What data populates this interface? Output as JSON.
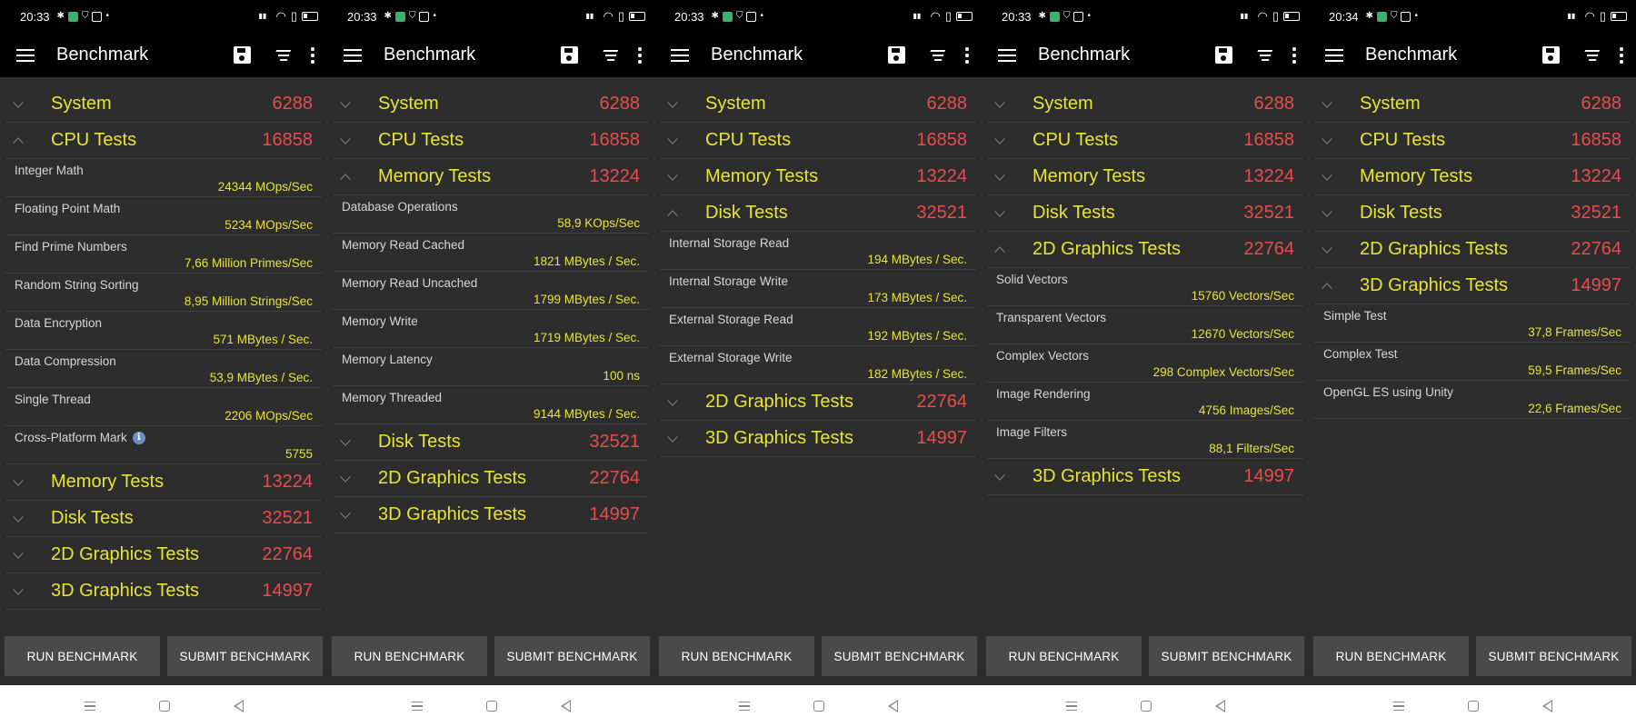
{
  "app": {
    "title": "Benchmark"
  },
  "buttons": {
    "run": "RUN BENCHMARK",
    "submit": "SUBMIT BENCHMARK"
  },
  "colors": {
    "category": "#e9e431",
    "score": "#ea4c4c",
    "value": "#e9e431",
    "background": "#2d2d2d"
  },
  "screens": [
    {
      "time": "20:33",
      "categories": [
        {
          "name": "System",
          "score": "6288",
          "expanded": false,
          "items": []
        },
        {
          "name": "CPU Tests",
          "score": "16858",
          "expanded": true,
          "items": [
            {
              "name": "Integer Math",
              "value": "24344 MOps/Sec"
            },
            {
              "name": "Floating Point Math",
              "value": "5234 MOps/Sec"
            },
            {
              "name": "Find Prime Numbers",
              "value": "7,66 Million Primes/Sec"
            },
            {
              "name": "Random String Sorting",
              "value": "8,95 Million Strings/Sec"
            },
            {
              "name": "Data Encryption",
              "value": "571 MBytes / Sec."
            },
            {
              "name": "Data Compression",
              "value": "53,9 MBytes / Sec."
            },
            {
              "name": "Single Thread",
              "value": "2206 MOps/Sec"
            },
            {
              "name": "Cross-Platform Mark",
              "value": "5755",
              "info": true
            }
          ]
        },
        {
          "name": "Memory Tests",
          "score": "13224",
          "expanded": false,
          "items": []
        },
        {
          "name": "Disk Tests",
          "score": "32521",
          "expanded": false,
          "items": []
        },
        {
          "name": "2D Graphics Tests",
          "score": "22764",
          "expanded": false,
          "items": []
        },
        {
          "name": "3D Graphics Tests",
          "score": "14997",
          "expanded": false,
          "items": []
        }
      ]
    },
    {
      "time": "20:33",
      "categories": [
        {
          "name": "System",
          "score": "6288",
          "expanded": false,
          "items": []
        },
        {
          "name": "CPU Tests",
          "score": "16858",
          "expanded": false,
          "items": []
        },
        {
          "name": "Memory Tests",
          "score": "13224",
          "expanded": true,
          "items": [
            {
              "name": "Database Operations",
              "value": "58,9 KOps/Sec"
            },
            {
              "name": "Memory Read Cached",
              "value": "1821 MBytes / Sec."
            },
            {
              "name": "Memory Read Uncached",
              "value": "1799 MBytes / Sec."
            },
            {
              "name": "Memory Write",
              "value": "1719 MBytes / Sec."
            },
            {
              "name": "Memory Latency",
              "value": "100 ns"
            },
            {
              "name": "Memory Threaded",
              "value": "9144 MBytes / Sec."
            }
          ]
        },
        {
          "name": "Disk Tests",
          "score": "32521",
          "expanded": false,
          "items": []
        },
        {
          "name": "2D Graphics Tests",
          "score": "22764",
          "expanded": false,
          "items": []
        },
        {
          "name": "3D Graphics Tests",
          "score": "14997",
          "expanded": false,
          "items": []
        }
      ]
    },
    {
      "time": "20:33",
      "categories": [
        {
          "name": "System",
          "score": "6288",
          "expanded": false,
          "items": []
        },
        {
          "name": "CPU Tests",
          "score": "16858",
          "expanded": false,
          "items": []
        },
        {
          "name": "Memory Tests",
          "score": "13224",
          "expanded": false,
          "items": []
        },
        {
          "name": "Disk Tests",
          "score": "32521",
          "expanded": true,
          "items": [
            {
              "name": "Internal Storage Read",
              "value": "194 MBytes / Sec."
            },
            {
              "name": "Internal Storage Write",
              "value": "173 MBytes / Sec."
            },
            {
              "name": "External Storage Read",
              "value": "192 MBytes / Sec."
            },
            {
              "name": "External Storage Write",
              "value": "182 MBytes / Sec."
            }
          ]
        },
        {
          "name": "2D Graphics Tests",
          "score": "22764",
          "expanded": false,
          "items": []
        },
        {
          "name": "3D Graphics Tests",
          "score": "14997",
          "expanded": false,
          "items": []
        }
      ]
    },
    {
      "time": "20:33",
      "categories": [
        {
          "name": "System",
          "score": "6288",
          "expanded": false,
          "items": []
        },
        {
          "name": "CPU Tests",
          "score": "16858",
          "expanded": false,
          "items": []
        },
        {
          "name": "Memory Tests",
          "score": "13224",
          "expanded": false,
          "items": []
        },
        {
          "name": "Disk Tests",
          "score": "32521",
          "expanded": false,
          "items": []
        },
        {
          "name": "2D Graphics Tests",
          "score": "22764",
          "expanded": true,
          "items": [
            {
              "name": "Solid Vectors",
              "value": "15760 Vectors/Sec"
            },
            {
              "name": "Transparent Vectors",
              "value": "12670 Vectors/Sec"
            },
            {
              "name": "Complex Vectors",
              "value": "298 Complex Vectors/Sec"
            },
            {
              "name": "Image Rendering",
              "value": "4756 Images/Sec"
            },
            {
              "name": "Image Filters",
              "value": "88,1 Filters/Sec"
            }
          ]
        },
        {
          "name": "3D Graphics Tests",
          "score": "14997",
          "expanded": false,
          "items": []
        }
      ]
    },
    {
      "time": "20:34",
      "categories": [
        {
          "name": "System",
          "score": "6288",
          "expanded": false,
          "items": []
        },
        {
          "name": "CPU Tests",
          "score": "16858",
          "expanded": false,
          "items": []
        },
        {
          "name": "Memory Tests",
          "score": "13224",
          "expanded": false,
          "items": []
        },
        {
          "name": "Disk Tests",
          "score": "32521",
          "expanded": false,
          "items": []
        },
        {
          "name": "2D Graphics Tests",
          "score": "22764",
          "expanded": false,
          "items": []
        },
        {
          "name": "3D Graphics Tests",
          "score": "14997",
          "expanded": true,
          "items": [
            {
              "name": "Simple Test",
              "value": "37,8 Frames/Sec"
            },
            {
              "name": "Complex Test",
              "value": "59,5 Frames/Sec"
            },
            {
              "name": "OpenGL ES using Unity",
              "value": "22,6 Frames/Sec"
            }
          ]
        }
      ]
    }
  ]
}
